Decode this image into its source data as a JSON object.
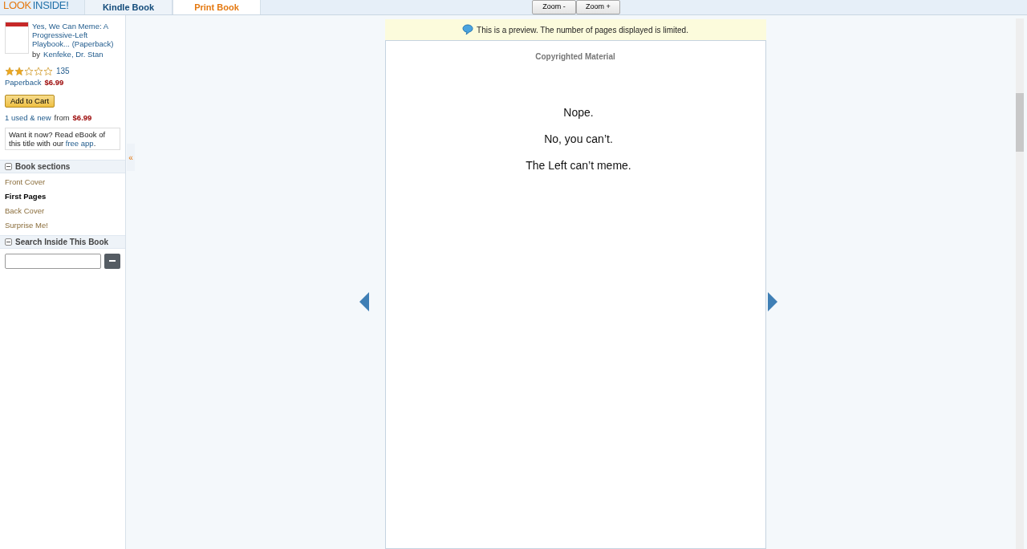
{
  "logo": {
    "part_1": "LOOK",
    "part_2": "INSIDE!"
  },
  "tabs": [
    {
      "label": "Kindle Book",
      "selected": false
    },
    {
      "label": "Print Book",
      "selected": true
    }
  ],
  "zoom_buttons": [
    "Zoom -",
    "Zoom +"
  ],
  "book": {
    "title": "Yes, We Can Meme: A Progressive-Left Playbook... (Paperback)",
    "by": "by",
    "author": "Kenfeke, Dr. Stan",
    "stars": 2,
    "review_count": "135",
    "format": "Paperback",
    "price": "$6.99",
    "add_to_cart": "Add to Cart",
    "offers_link": "1 used & new",
    "offers_from": "from",
    "offers_price": "$6.99",
    "ebook_text": "Want it now? Read eBook of this title with our",
    "ebook_link": "free app",
    "ebook_end": "."
  },
  "collapse_toggle": "«",
  "sections": {
    "heading": "Book sections",
    "items": [
      {
        "label": "Front Cover",
        "selected": false
      },
      {
        "label": "First Pages",
        "selected": true
      },
      {
        "label": "Back Cover",
        "selected": false
      },
      {
        "label": "Surprise Me!",
        "selected": false
      }
    ]
  },
  "search": {
    "heading": "Search Inside This Book"
  },
  "notice": "This is a preview. The number of pages displayed is limited.",
  "page": {
    "header": "Copyrighted Material",
    "lines": [
      "Nope.",
      "No, you can’t.",
      "The Left can’t meme."
    ]
  }
}
